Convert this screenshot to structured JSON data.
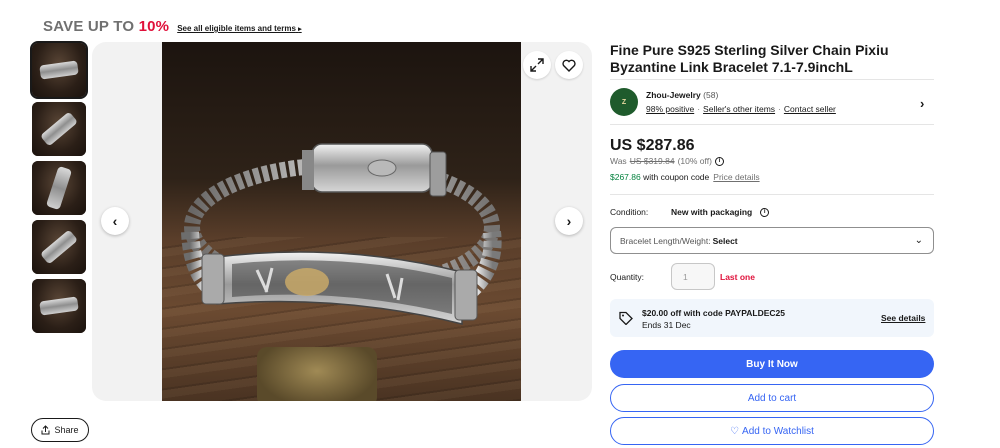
{
  "promo": {
    "prefix": "SAVE UP TO",
    "percent": "10%",
    "link": "See all eligible items and terms"
  },
  "gallery": {
    "thumbnail_count": 5,
    "active_index": 0
  },
  "share": {
    "label": "Share"
  },
  "listing": {
    "title": "Fine Pure S925 Sterling Silver Chain Pixiu Byzantine Link Bracelet 7.1-7.9inchL"
  },
  "seller": {
    "name": "Zhou-Jewelry",
    "feedback_count": "(58)",
    "positive": "98% positive",
    "other_items": "Seller's other items",
    "contact": "Contact seller"
  },
  "pricing": {
    "price": "US $287.86",
    "was_label": "Was",
    "was_price": "US $319.84",
    "discount": "(10% off)",
    "coupon_price": "$267.86",
    "coupon_text": "with coupon code",
    "price_details": "Price details"
  },
  "condition": {
    "label": "Condition:",
    "value": "New with packaging"
  },
  "variation": {
    "label": "Bracelet Length/Weight:",
    "value": "Select"
  },
  "quantity": {
    "label": "Quantity:",
    "placeholder": "1",
    "stock_note": "Last one"
  },
  "offer": {
    "headline": "$20.00 off with code PAYPALDEC25",
    "ends": "Ends 31 Dec",
    "link": "See details"
  },
  "actions": {
    "buy_now": "Buy It Now",
    "add_to_cart": "Add to cart",
    "watchlist": "Add to Watchlist"
  },
  "colors": {
    "accent_blue": "#3665f3",
    "alert_red": "#e0103a",
    "positive_green": "#05823f"
  },
  "icons": {
    "expand": "expand-icon",
    "favorite": "heart-icon",
    "prev": "chevron-left-icon",
    "next": "chevron-right-icon",
    "share": "share-icon",
    "offer": "tag-icon",
    "info": "info-icon"
  }
}
